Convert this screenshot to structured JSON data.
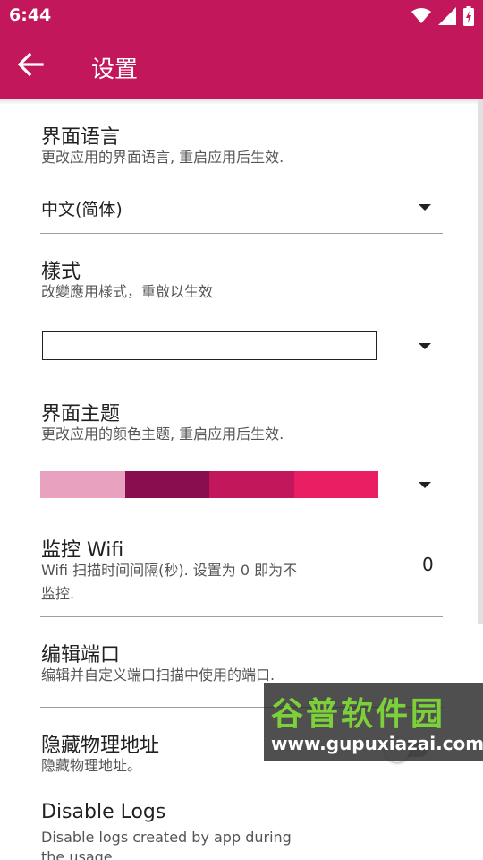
{
  "status_bar": {
    "time": "6:44",
    "icons": [
      "wifi-icon",
      "signal-icon",
      "battery-icon"
    ]
  },
  "app_bar": {
    "title": "设置",
    "back_icon": "arrow-back-icon",
    "color": "#c2185b"
  },
  "preferences": {
    "language": {
      "title": "界面语言",
      "summary": "更改应用的界面语言, 重启应用后生效.",
      "value": "中文(简体)"
    },
    "style": {
      "title": "樣式",
      "summary": "改變應用樣式，重啟以生效",
      "value": ""
    },
    "theme": {
      "title": "界面主题",
      "summary": "更改应用的颜色主题, 重启应用后生效.",
      "swatches": [
        "#e8a1bf",
        "#880e4f",
        "#c2185b",
        "#e91e63"
      ]
    },
    "wifi_monitor": {
      "title": "监控 Wifi",
      "summary_line1": "Wifi 扫描时间间隔(秒). 设置为 0 即为不",
      "summary_line2": "监控.",
      "value": "0"
    },
    "edit_ports": {
      "title": "编辑端口",
      "summary": "编辑并自定义端口扫描中使用的端口."
    },
    "hide_mac": {
      "title": "隐藏物理地址",
      "summary": "隐藏物理地址。",
      "enabled": false
    },
    "disable_logs": {
      "title": "Disable Logs",
      "summary_line1": "Disable logs created by app during",
      "summary_line2": "the usage"
    }
  },
  "watermark": {
    "title": "谷普软件园",
    "url": "www.gupuxiazai.com"
  }
}
